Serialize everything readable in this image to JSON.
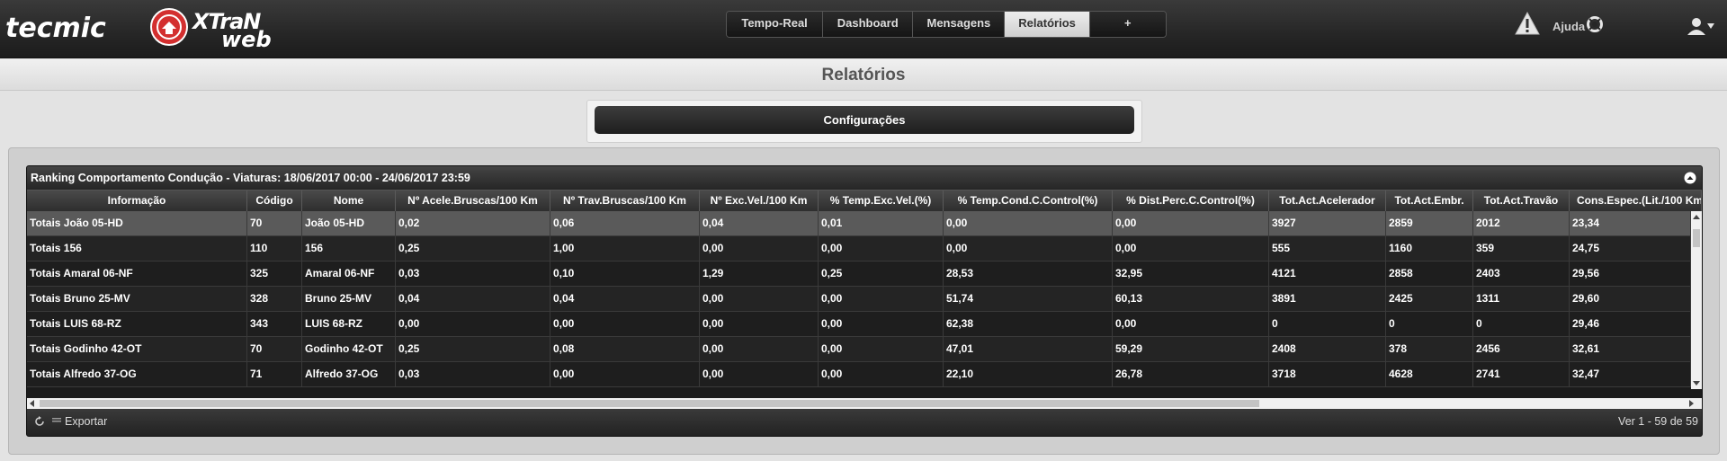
{
  "brand": {
    "tecmic": "tecmic",
    "xtran": "XTraN",
    "web": "web"
  },
  "nav": {
    "tabs": [
      {
        "label": "Tempo-Real",
        "active": false
      },
      {
        "label": "Dashboard",
        "active": false
      },
      {
        "label": "Mensagens",
        "active": false
      },
      {
        "label": "Relatórios",
        "active": true
      },
      {
        "label": "+",
        "active": false
      }
    ],
    "help_label": "Ajuda"
  },
  "page": {
    "title": "Relatórios",
    "config_button": "Configurações"
  },
  "grid": {
    "caption": "Ranking Comportamento Condução - Viaturas: 18/06/2017 00:00 - 24/06/2017 23:59",
    "columns": [
      "Informação",
      "Código",
      "Nome",
      "Nº Acele.Bruscas/100 Km",
      "Nº Trav.Bruscas/100 Km",
      "Nº Exc.Vel./100 Km",
      "% Temp.Exc.Vel.(%)",
      "% Temp.Cond.C.Control(%)",
      "% Dist.Perc.C.Control(%)",
      "Tot.Act.Acelerador",
      "Tot.Act.Embr.",
      "Tot.Act.Travão",
      "Cons.Espec.(Lit./100 Km"
    ],
    "rows": [
      [
        "Totais João 05-HD",
        "70",
        "João 05-HD",
        "0,02",
        "0,06",
        "0,04",
        "0,01",
        "0,00",
        "0,00",
        "3927",
        "2859",
        "2012",
        "23,34"
      ],
      [
        "Totais 156",
        "110",
        "156",
        "0,25",
        "1,00",
        "0,00",
        "0,00",
        "0,00",
        "0,00",
        "555",
        "1160",
        "359",
        "24,75"
      ],
      [
        "Totais Amaral 06-NF",
        "325",
        "Amaral 06-NF",
        "0,03",
        "0,10",
        "1,29",
        "0,25",
        "28,53",
        "32,95",
        "4121",
        "2858",
        "2403",
        "29,56"
      ],
      [
        "Totais Bruno 25-MV",
        "328",
        "Bruno 25-MV",
        "0,04",
        "0,04",
        "0,00",
        "0,00",
        "51,74",
        "60,13",
        "3891",
        "2425",
        "1311",
        "29,60"
      ],
      [
        "Totais LUIS 68-RZ",
        "343",
        "LUIS 68-RZ",
        "0,00",
        "0,00",
        "0,00",
        "0,00",
        "62,38",
        "0,00",
        "0",
        "0",
        "0",
        "29,46"
      ],
      [
        "Totais Godinho 42-OT",
        "70",
        "Godinho 42-OT",
        "0,25",
        "0,08",
        "0,00",
        "0,00",
        "47,01",
        "59,29",
        "2408",
        "378",
        "2456",
        "32,61"
      ],
      [
        "Totais Alfredo 37-OG",
        "71",
        "Alfredo 37-OG",
        "0,03",
        "0,00",
        "0,00",
        "0,00",
        "22,10",
        "26,78",
        "3718",
        "4628",
        "2741",
        "32,47"
      ]
    ],
    "selected_row": 0,
    "export_label": "Exportar",
    "pager_info": "Ver 1 - 59 de 59"
  },
  "colors": {
    "accent": "#d32f2f",
    "topbar": "#262626",
    "grid_bg": "#1b1b1b",
    "selected_row": "#5a5a5a"
  }
}
